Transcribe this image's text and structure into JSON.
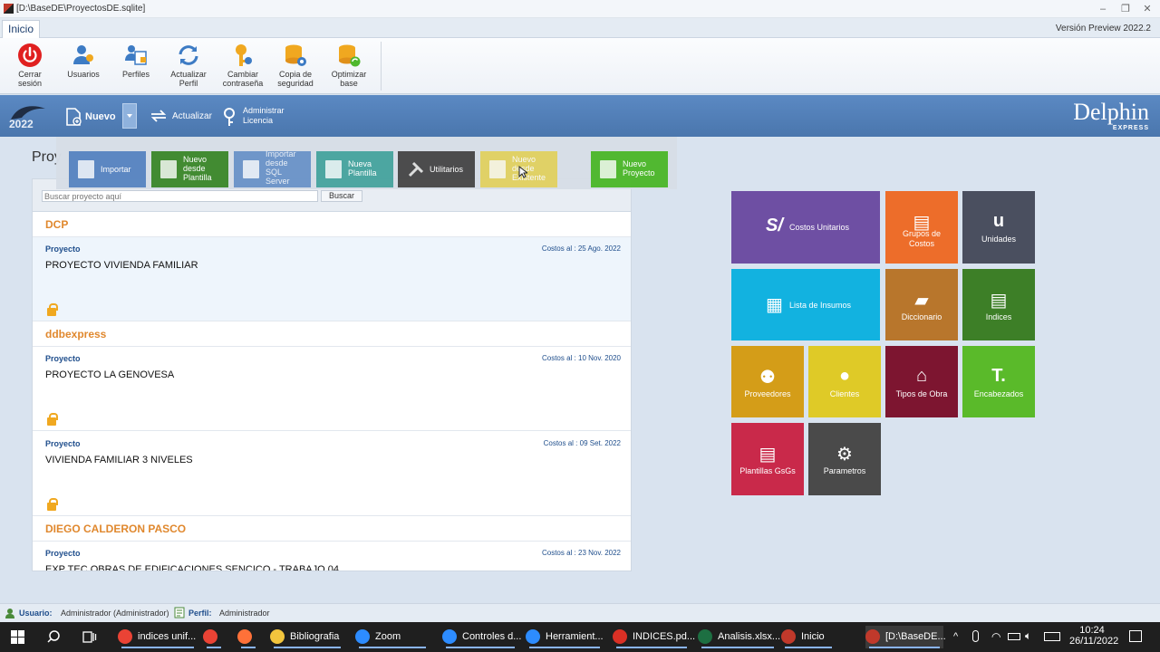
{
  "window": {
    "title": "[D:\\BaseDE\\ProyectosDE.sqlite]"
  },
  "tabs": {
    "inicio": "Inicio",
    "version": "Versión Preview 2022.2"
  },
  "ribbon": [
    {
      "l1": "Cerrar",
      "l2": "sesión",
      "icon": "power-icon"
    },
    {
      "l1": "Usuarios",
      "l2": "",
      "icon": "users-icon"
    },
    {
      "l1": "Perfiles",
      "l2": "",
      "icon": "profiles-icon"
    },
    {
      "l1": "Actualizar",
      "l2": "Perfil",
      "icon": "refresh-icon"
    },
    {
      "l1": "Cambiar",
      "l2": "contraseña",
      "icon": "key-icon"
    },
    {
      "l1": "Copia de",
      "l2": "seguridad",
      "icon": "database-gear-icon"
    },
    {
      "l1": "Optimizar",
      "l2": "base",
      "icon": "database-refresh-icon"
    }
  ],
  "navbar": {
    "year": "2022",
    "nuevo": "Nuevo",
    "actualizar": "Actualizar",
    "admin1": "Administrar",
    "admin2": "Licencia",
    "brand": "Delphin",
    "brand_sub": "EXPRESS"
  },
  "popup": [
    {
      "label": "Importar",
      "color": "#5a86c2"
    },
    {
      "label": "Nuevo\ndesde\nPlantilla",
      "color": "#3f8a2f"
    },
    {
      "label": "Importar\ndesde\nSQL\nServer",
      "color": "#6d95c9"
    },
    {
      "label": "Nueva\nPlantilla",
      "color": "#4aa5a0"
    },
    {
      "label": "Utilitarios",
      "color": "#4a4a4a"
    },
    {
      "label": "Nuevo\ndesde\nExistente",
      "color": "#e3cf4e"
    },
    {
      "label": "Nuevo\nProyecto",
      "color": "#4fb82e"
    }
  ],
  "page": {
    "title": "Proy",
    "search_placeholder": "Buscar proyecto aquí",
    "search_button": "Buscar"
  },
  "groups": [
    {
      "name": "DCP"
    },
    {
      "name": "ddbexpress"
    },
    {
      "name": "DIEGO CALDERON PASCO"
    }
  ],
  "projects": [
    {
      "kind": "Proyecto",
      "costs": "Costos al : 25 Ago. 2022",
      "name": "PROYECTO VIVIENDA FAMILIAR"
    },
    {
      "kind": "Proyecto",
      "costs": "Costos al : 10 Nov. 2020",
      "name": "PROYECTO LA GENOVESA"
    },
    {
      "kind": "Proyecto",
      "costs": "Costos al : 09 Set. 2022",
      "name": "VIVIENDA FAMILIAR 3 NIVELES"
    },
    {
      "kind": "Proyecto",
      "costs": "Costos al : 23 Nov. 2022",
      "name": "EXP TEC OBRAS DE EDIFICACIONES SENCICO - TRABAJO 04"
    }
  ],
  "tiles": [
    {
      "label": "Costos Unitarios",
      "icon": "S/",
      "color": "#6e4fa3"
    },
    {
      "label": "Grupos de\nCostos",
      "icon": "▤",
      "color": "#ed6d2a"
    },
    {
      "label": "Unidades",
      "icon": "u",
      "color": "#4a4f5f"
    },
    {
      "label": "Lista de Insumos",
      "icon": "▦",
      "color": "#12b2e0"
    },
    {
      "label": "Diccionario",
      "icon": "▰",
      "color": "#b8762c"
    },
    {
      "label": "Indices",
      "icon": "▤",
      "color": "#3d7f27"
    },
    {
      "label": "Proveedores",
      "icon": "⚉",
      "color": "#d49d18"
    },
    {
      "label": "Clientes",
      "icon": "●",
      "color": "#dfca27"
    },
    {
      "label": "Tipos de Obra",
      "icon": "⌂",
      "color": "#7d1530"
    },
    {
      "label": "Encabezados",
      "icon": "T.",
      "color": "#5aba2a"
    },
    {
      "label": "Plantillas GsGs",
      "icon": "▤",
      "color": "#c9294a"
    },
    {
      "label": "Parametros",
      "icon": "⚙",
      "color": "#4a4a4a"
    }
  ],
  "status": {
    "user_label": "Usuario:",
    "user": "Administrador (Administrador)",
    "profile_label": "Perfil:",
    "profile": "Administrador"
  },
  "taskbar": {
    "apps": [
      {
        "label": "indices unif...",
        "color": "#ea4335"
      },
      {
        "label": "",
        "color": "#ea4335"
      },
      {
        "label": "",
        "color": "#ff7139"
      },
      {
        "label": "Bibliografia",
        "color": "#f2c53d"
      },
      {
        "label": "Zoom",
        "color": "#2d8cff"
      },
      {
        "label": "Controles d...",
        "color": "#2d8cff"
      },
      {
        "label": "Herramient...",
        "color": "#2d8cff"
      },
      {
        "label": "INDICES.pd...",
        "color": "#d93025"
      },
      {
        "label": "Analisis.xlsx...",
        "color": "#1d6f42"
      },
      {
        "label": "Inicio",
        "color": "#c0392b"
      },
      {
        "label": "[D:\\BaseDE...",
        "color": "#c0392b"
      }
    ],
    "time": "10:24",
    "date": "26/11/2022"
  }
}
